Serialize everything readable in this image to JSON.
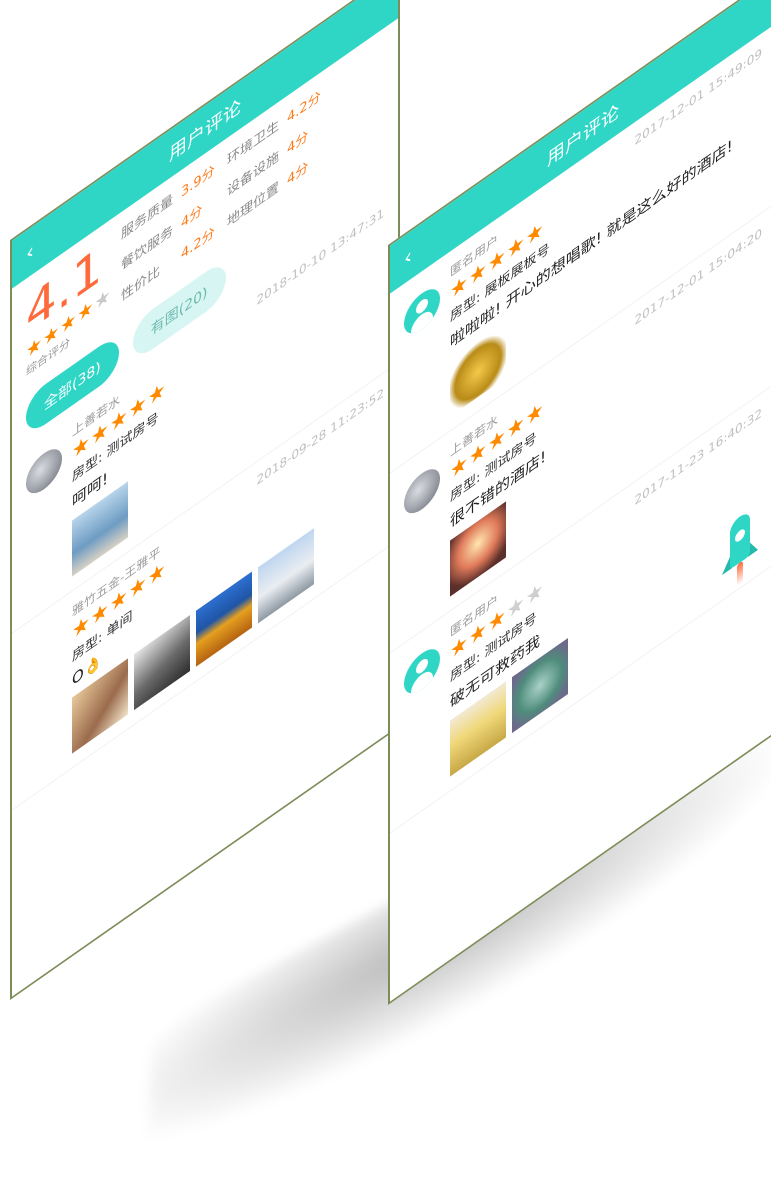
{
  "left": {
    "header": {
      "back_icon": "‹",
      "title": "用户评论"
    },
    "summary": {
      "score": "4.1",
      "stars": "★★★★",
      "stars_off": "★",
      "label": "综合评分",
      "metrics": [
        {
          "name": "服务质量",
          "value": "3.9分"
        },
        {
          "name": "环境卫生",
          "value": "4.2分"
        },
        {
          "name": "餐饮服务",
          "value": "4分"
        },
        {
          "name": "设备设施",
          "value": "4分"
        },
        {
          "name": "性价比",
          "value": "4.2分"
        },
        {
          "name": "地理位置",
          "value": "4分"
        }
      ]
    },
    "filters": {
      "all": "全部(38)",
      "with_images": "有图(20)"
    },
    "reviews": [
      {
        "user": "上善若水",
        "stars": "★★★★★",
        "stars_off": "",
        "room": "房型: 测试房号",
        "text": "呵呵!",
        "date": "2018-10-10 13:47:31"
      },
      {
        "user": "雅竹五金-王雅平",
        "stars": "★★★★★",
        "stars_off": "",
        "room": "房型: 单间",
        "text": "O👌",
        "date": "2018-09-28 11:23:52"
      }
    ]
  },
  "right": {
    "header": {
      "back_icon": "‹",
      "title": "用户评论"
    },
    "reviews": [
      {
        "user": "匿名用户",
        "stars": "★★★★★",
        "stars_off": "",
        "room": "房型: 展板展板号",
        "text": "啦啦啦! 开心的想唱歌! 就是这么好的酒店!",
        "date": "2017-12-01 15:49:09"
      },
      {
        "user": "上善若水",
        "stars": "★★★★★",
        "stars_off": "",
        "room": "房型: 测试房号",
        "text": "很不错的酒店!",
        "date": "2017-12-01 15:04:20"
      },
      {
        "user": "匿名用户",
        "stars": "★★★",
        "stars_off": "★★",
        "room": "房型: 测试房号",
        "text": "破无可救药我",
        "date": "2017-11-23 16:40:32"
      }
    ]
  },
  "colors": {
    "accent": "#2fd6c6",
    "score": "#ff6a3d",
    "star": "#ff8a00"
  },
  "icons": {
    "back": "chevron-left-icon",
    "rocket": "rocket-icon",
    "anon_avatar": "user-icon"
  }
}
